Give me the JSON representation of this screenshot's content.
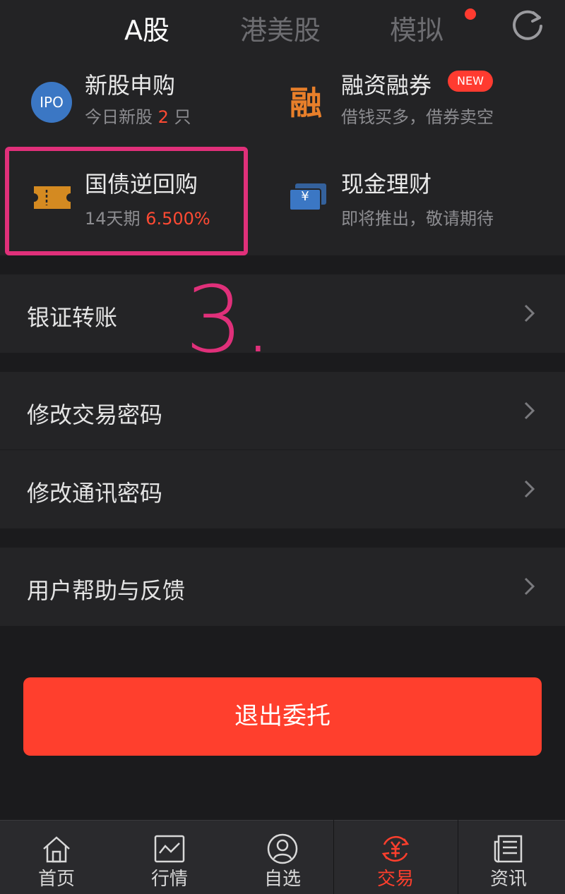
{
  "header": {
    "tabs": [
      {
        "label": "A股",
        "active": true
      },
      {
        "label": "港美股",
        "active": false
      },
      {
        "label": "模拟",
        "active": false
      }
    ],
    "refresh_icon": "refresh-icon"
  },
  "features": [
    {
      "title": "新股申购",
      "sub_prefix": "今日新股 ",
      "sub_highlight": "2",
      "sub_suffix": " 只",
      "icon": "ipo-icon",
      "icon_text": "IPO"
    },
    {
      "title": "融资融券",
      "badge": "NEW",
      "sub": "借钱买多，借券卖空",
      "icon": "margin-icon",
      "icon_text": "融"
    },
    {
      "title": "国债逆回购",
      "sub_prefix": "14天期 ",
      "sub_highlight": "6.500%",
      "icon": "ticket-icon"
    },
    {
      "title": "现金理财",
      "sub": "即将推出，敬请期待",
      "icon": "cash-icon",
      "icon_text": "¥"
    }
  ],
  "annotation": "3.",
  "menu": {
    "transfer": "银证转账",
    "trade_password": "修改交易密码",
    "comm_password": "修改通讯密码",
    "help": "用户帮助与反馈"
  },
  "logout_label": "退出委托",
  "bottom_nav": [
    {
      "label": "首页",
      "icon": "home-icon"
    },
    {
      "label": "行情",
      "icon": "market-icon"
    },
    {
      "label": "自选",
      "icon": "watchlist-icon"
    },
    {
      "label": "交易",
      "icon": "trade-icon",
      "active": true
    },
    {
      "label": "资讯",
      "icon": "news-icon"
    }
  ],
  "colors": {
    "accent": "#ff3f2d",
    "annotation": "#e0307a",
    "ipo_blue": "#3b77c4",
    "margin_orange": "#e87f2a",
    "ticket_gold": "#d48a21"
  }
}
